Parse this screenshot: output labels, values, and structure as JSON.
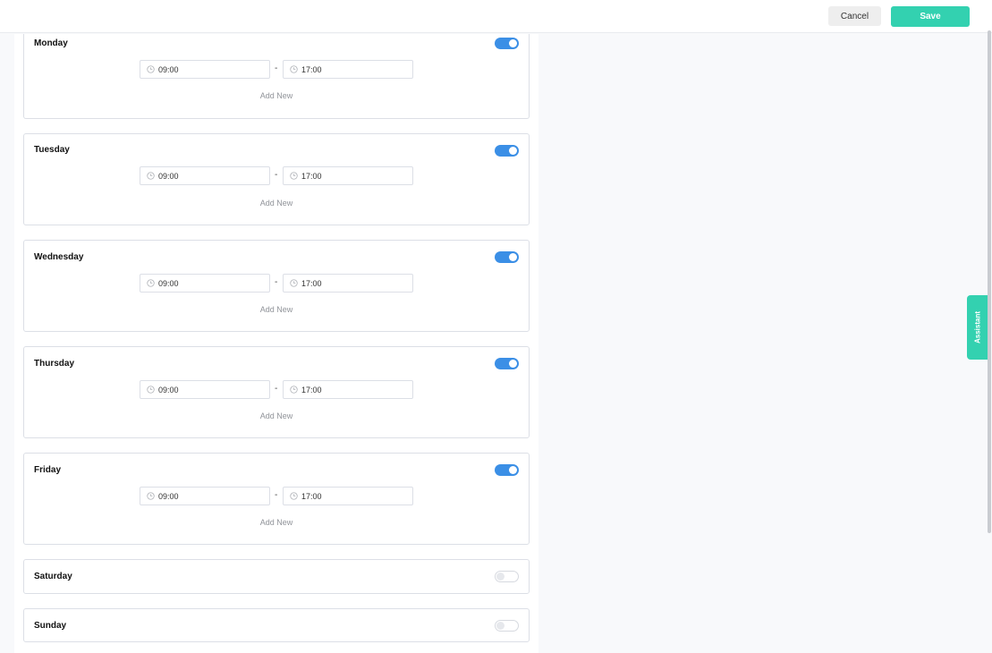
{
  "header": {
    "cancel_label": "Cancel",
    "save_label": "Save"
  },
  "days": [
    {
      "name": "Monday",
      "enabled": true,
      "start": "09:00",
      "end": "17:00",
      "separator": "-",
      "add_label": "Add New"
    },
    {
      "name": "Tuesday",
      "enabled": true,
      "start": "09:00",
      "end": "17:00",
      "separator": "-",
      "add_label": "Add New"
    },
    {
      "name": "Wednesday",
      "enabled": true,
      "start": "09:00",
      "end": "17:00",
      "separator": "-",
      "add_label": "Add New"
    },
    {
      "name": "Thursday",
      "enabled": true,
      "start": "09:00",
      "end": "17:00",
      "separator": "-",
      "add_label": "Add New"
    },
    {
      "name": "Friday",
      "enabled": true,
      "start": "09:00",
      "end": "17:00",
      "separator": "-",
      "add_label": "Add New"
    },
    {
      "name": "Saturday",
      "enabled": false
    },
    {
      "name": "Sunday",
      "enabled": false
    }
  ],
  "assistant_label": "Assistant",
  "colors": {
    "accent": "#33d1b0",
    "toggle_on": "#3b8fe6",
    "border": "#dcdfe6"
  },
  "icons": {
    "time": "clock-icon"
  }
}
